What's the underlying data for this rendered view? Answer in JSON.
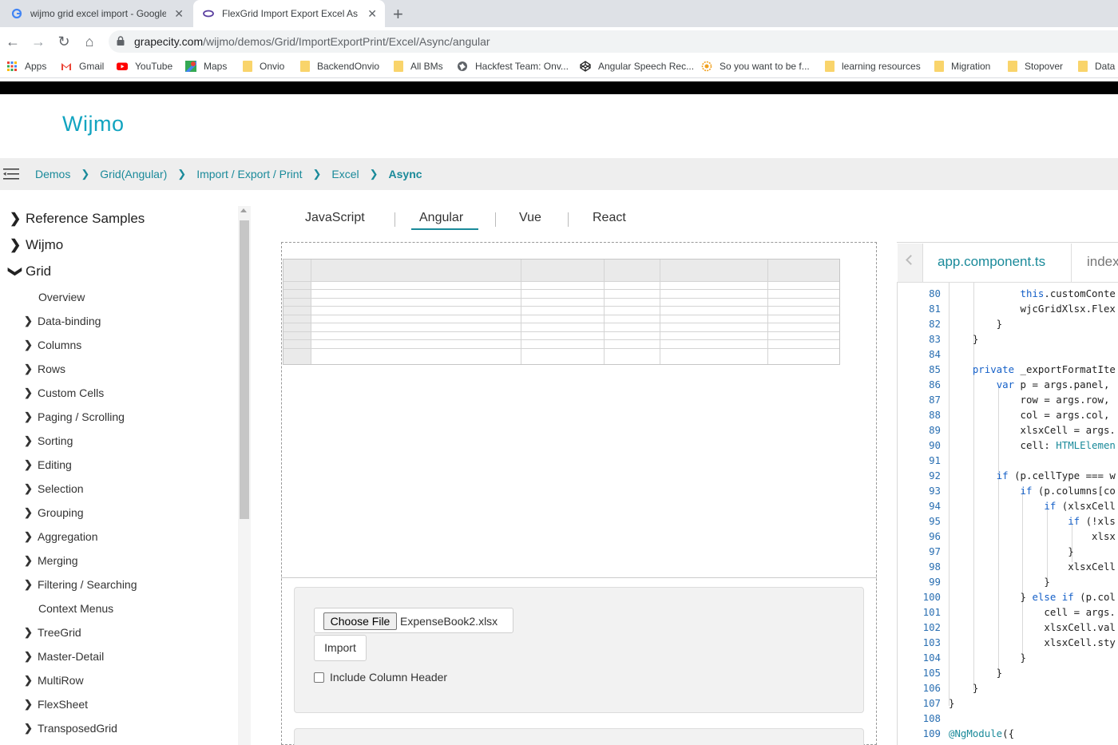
{
  "browser": {
    "tabs": [
      {
        "title": "wijmo grid excel import - Google Search",
        "active": false
      },
      {
        "title": "FlexGrid Import Export Excel Async",
        "active": true
      }
    ],
    "url_host": "grapecity.com",
    "url_path": "/wijmo/demos/Grid/ImportExportPrint/Excel/Async/angular",
    "bookmarks": [
      "Apps",
      "Gmail",
      "YouTube",
      "Maps",
      "Onvio",
      "BackendOnvio",
      "All BMs",
      "Hackfest Team: Onv...",
      "Angular Speech Rec...",
      "So you want to be f...",
      "learning resources",
      "Migration",
      "Stopover",
      "Data"
    ]
  },
  "site": {
    "logo": "Wijmo",
    "breadcrumb": [
      "Demos",
      "Grid(Angular)",
      "Import / Export / Print",
      "Excel",
      "Async"
    ]
  },
  "sidebar": {
    "top_items": [
      {
        "label": "Reference Samples",
        "expanded": false
      },
      {
        "label": "Wijmo",
        "expanded": false
      },
      {
        "label": "Grid",
        "expanded": true
      }
    ],
    "grid_items": [
      {
        "label": "Overview",
        "has_children": false
      },
      {
        "label": "Data-binding",
        "has_children": true
      },
      {
        "label": "Columns",
        "has_children": true
      },
      {
        "label": "Rows",
        "has_children": true
      },
      {
        "label": "Custom Cells",
        "has_children": true
      },
      {
        "label": "Paging / Scrolling",
        "has_children": true
      },
      {
        "label": "Sorting",
        "has_children": true
      },
      {
        "label": "Editing",
        "has_children": true
      },
      {
        "label": "Selection",
        "has_children": true
      },
      {
        "label": "Grouping",
        "has_children": true
      },
      {
        "label": "Aggregation",
        "has_children": true
      },
      {
        "label": "Merging",
        "has_children": true
      },
      {
        "label": "Filtering / Searching",
        "has_children": true
      },
      {
        "label": "Context Menus",
        "has_children": false
      },
      {
        "label": "TreeGrid",
        "has_children": true
      },
      {
        "label": "Master-Detail",
        "has_children": true
      },
      {
        "label": "MultiRow",
        "has_children": true
      },
      {
        "label": "FlexSheet",
        "has_children": true
      },
      {
        "label": "TransposedGrid",
        "has_children": true
      }
    ]
  },
  "framework_tabs": [
    "JavaScript",
    "Angular",
    "Vue",
    "React"
  ],
  "active_framework": "Angular",
  "demo": {
    "choose_file_label": "Choose File",
    "file_name": "ExpenseBook2.xlsx",
    "import_label": "Import",
    "include_header_label": "Include Column Header",
    "include_header_checked": false
  },
  "code": {
    "tabs": [
      "app.component.ts",
      "index"
    ],
    "active_tab": "app.component.ts",
    "lines": [
      {
        "n": "80",
        "t": "            this.customConte"
      },
      {
        "n": "81",
        "t": "            wjcGridXlsx.Flex"
      },
      {
        "n": "82",
        "t": "        }"
      },
      {
        "n": "83",
        "t": "    }"
      },
      {
        "n": "84",
        "t": ""
      },
      {
        "n": "85",
        "t": "    private _exportFormatIte"
      },
      {
        "n": "86",
        "t": "        var p = args.panel,"
      },
      {
        "n": "87",
        "t": "            row = args.row,"
      },
      {
        "n": "88",
        "t": "            col = args.col,"
      },
      {
        "n": "89",
        "t": "            xlsxCell = args."
      },
      {
        "n": "90",
        "t": "            cell: HTMLElemen"
      },
      {
        "n": "91",
        "t": ""
      },
      {
        "n": "92",
        "t": "        if (p.cellType === w"
      },
      {
        "n": "93",
        "t": "            if (p.columns[co"
      },
      {
        "n": "94",
        "t": "                if (xlsxCell"
      },
      {
        "n": "95",
        "t": "                    if (!xls"
      },
      {
        "n": "96",
        "t": "                        xlsx"
      },
      {
        "n": "97",
        "t": "                    }"
      },
      {
        "n": "98",
        "t": "                    xlsxCell"
      },
      {
        "n": "99",
        "t": "                }"
      },
      {
        "n": "100",
        "t": "            } else if (p.col"
      },
      {
        "n": "101",
        "t": "                cell = args."
      },
      {
        "n": "102",
        "t": "                xlsxCell.val"
      },
      {
        "n": "103",
        "t": "                xlsxCell.sty"
      },
      {
        "n": "104",
        "t": "            }"
      },
      {
        "n": "105",
        "t": "        }"
      },
      {
        "n": "106",
        "t": "    }"
      },
      {
        "n": "107",
        "t": "}"
      },
      {
        "n": "108",
        "t": ""
      },
      {
        "n": "109",
        "t": "@NgModule({"
      }
    ]
  },
  "colors": {
    "accent": "#1a8a9a",
    "logo": "#12a4c0",
    "keyword": "#1560c8"
  }
}
